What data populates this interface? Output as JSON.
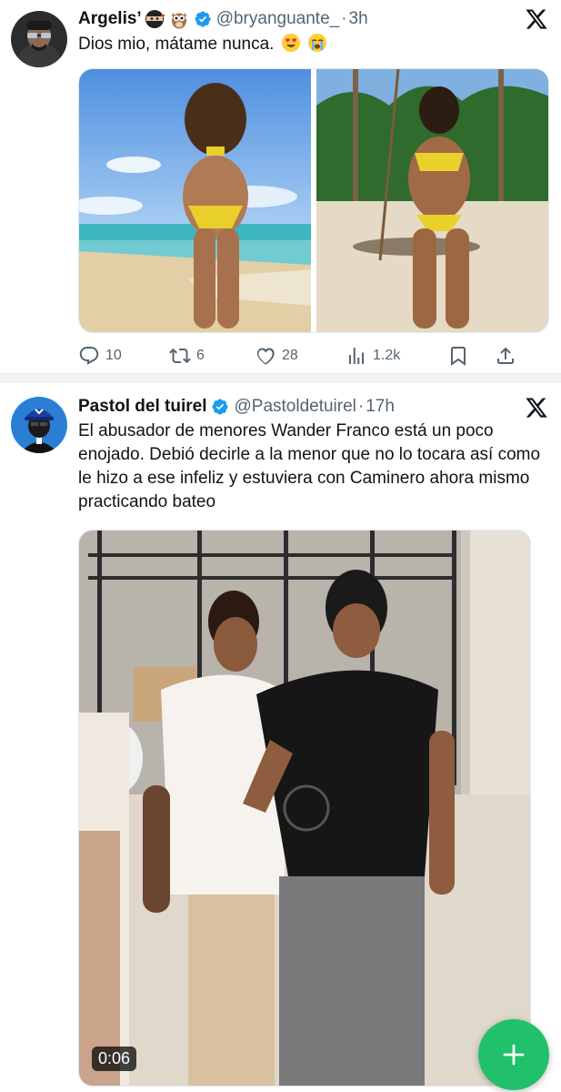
{
  "tweets": [
    {
      "name": "Argelis’",
      "handle": "@bryanguante_",
      "separator": "·",
      "time": "3h",
      "text": "Dios mio, mátame nunca.",
      "name_emojis": [
        "ninja-icon",
        "owl-icon"
      ],
      "text_emojis": [
        "heart-eyes-icon",
        "crying-face-icon"
      ],
      "media": [
        "photo",
        "photo"
      ],
      "stats": {
        "replies": "10",
        "reposts": "6",
        "likes": "28",
        "views": "1.2k"
      }
    },
    {
      "name": "Pastol del tuirel",
      "handle": "@Pastoldetuirel",
      "separator": "·",
      "time": "17h",
      "text": "El abusador de menores Wander Franco está un poco enojado. Debió decirle a la menor que no lo tocara así como le hizo a ese infeliz y estuviera con Caminero ahora mismo practicando bateo",
      "media": [
        "video"
      ],
      "video_duration": "0:06"
    }
  ],
  "colors": {
    "verified": "#1d9bf0",
    "secondary_text": "#536471",
    "fab": "#21c06b"
  }
}
